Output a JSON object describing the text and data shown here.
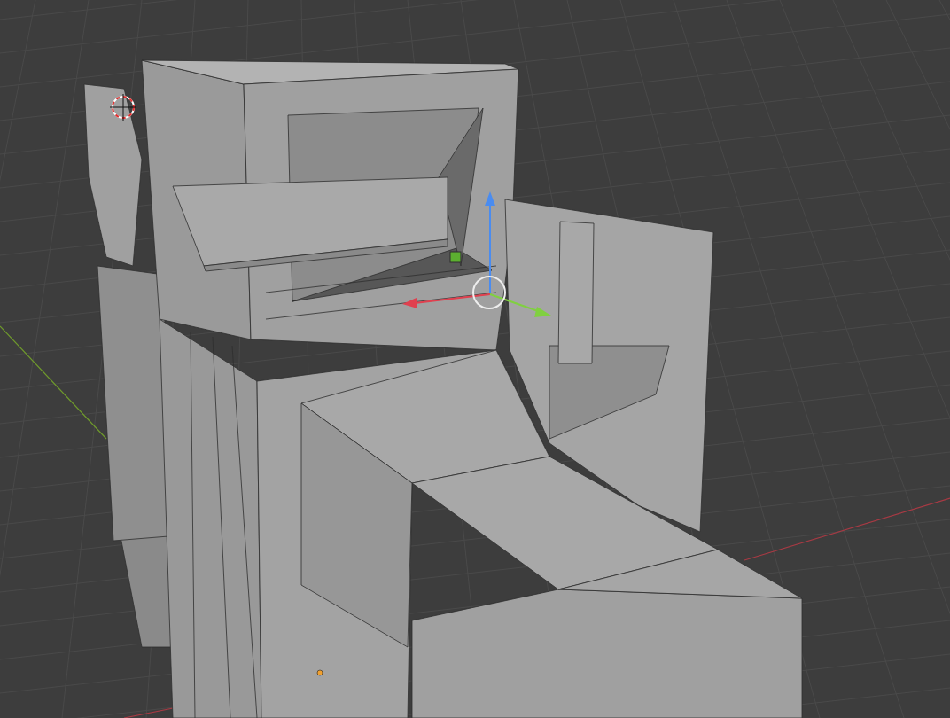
{
  "viewport": {
    "show_grid": true,
    "show_axes": true,
    "show_gizmo": true,
    "show_cursor": true,
    "show_origin": true
  }
}
